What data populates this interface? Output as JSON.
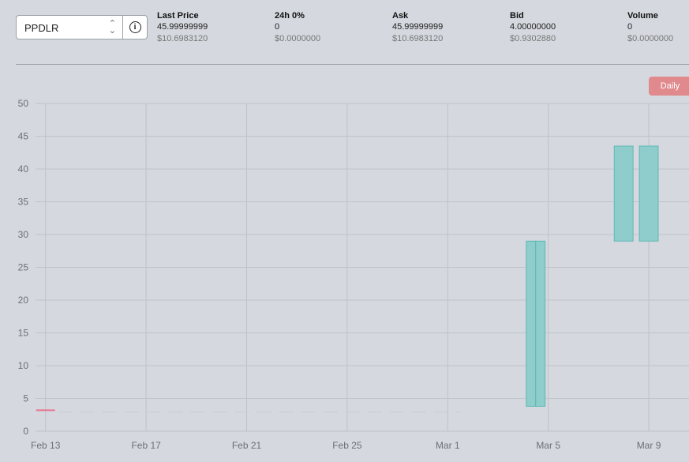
{
  "pair": {
    "selected": "PPDLR",
    "chevron_up": "⌃",
    "chevron_down": "⌄",
    "info_glyph": "i"
  },
  "stats": [
    {
      "label": "Last Price",
      "value": "45.99999999",
      "usd": "$10.6983120"
    },
    {
      "label": "24h 0%",
      "value": "0",
      "usd": "$0.0000000"
    },
    {
      "label": "Ask",
      "value": "45.99999999",
      "usd": "$10.6983120"
    },
    {
      "label": "Bid",
      "value": "4.00000000",
      "usd": "$0.9302880"
    },
    {
      "label": "Volume",
      "value": "0",
      "usd": "$0.0000000"
    }
  ],
  "interval_button": "Daily",
  "colors": {
    "up": "#8ecdcb",
    "up_border": "#5fb8b5",
    "down": "#e8728d",
    "grid": "#bfc3ca",
    "faint": "#c9ccd2"
  },
  "chart_data": {
    "type": "candlestick",
    "ylim": [
      0,
      50
    ],
    "y_ticks": [
      0,
      5,
      10,
      15,
      20,
      25,
      30,
      35,
      40,
      45,
      50
    ],
    "x_tick_labels": [
      "Feb 13",
      "Feb 17",
      "Feb 21",
      "Feb 25",
      "Mar 1",
      "Mar 5",
      "Mar 9"
    ],
    "x_tick_days": [
      13,
      17,
      21,
      25,
      29,
      33,
      37
    ],
    "xlim_days": [
      12.6,
      38.6
    ],
    "candles": [
      {
        "day": 13,
        "open": 3.2,
        "close": 3.2,
        "color": "down"
      },
      {
        "day": 36,
        "open": 29,
        "close": 43.5,
        "color": "up"
      },
      {
        "day": 37,
        "open": 29,
        "close": 43.5,
        "color": "up"
      }
    ],
    "split_candle": {
      "day": 32.5,
      "open": 3.8,
      "close": 29,
      "color": "up"
    },
    "faint_line": {
      "from_day": 13.5,
      "to_day": 29.5,
      "value": 2.9
    }
  }
}
